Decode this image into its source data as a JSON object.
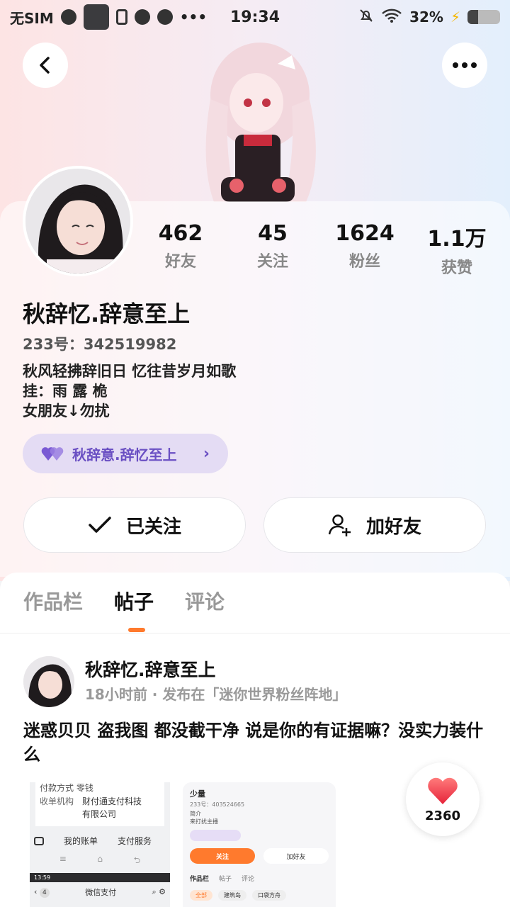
{
  "status_bar": {
    "carrier": "无SIM",
    "time": "19:34",
    "battery": "32%",
    "battery_level": 0.32
  },
  "header": {
    "back_icon": "chevron-left-icon",
    "more_icon": "more-horizontal-icon"
  },
  "profile": {
    "nickname": "秋辞忆.辞意至上",
    "uid": "233号：342519982",
    "bio_lines": [
      "秋风轻拂辞旧日 忆往昔岁月如歌",
      "挂：雨 露 桅",
      "女朋友↓勿扰"
    ],
    "tag_label": "秋辞意.辞忆至上",
    "stats": [
      {
        "num": "462",
        "label": "好友"
      },
      {
        "num": "45",
        "label": "关注"
      },
      {
        "num": "1624",
        "label": "粉丝"
      },
      {
        "num": "1.1万",
        "label": "获赞"
      }
    ]
  },
  "actions": {
    "follow_label": "已关注",
    "add_friend_label": "加好友"
  },
  "tabs": [
    "作品栏",
    "帖子",
    "评论"
  ],
  "active_tab": 1,
  "post": {
    "author": "秋辞忆.辞意至上",
    "meta": "18小时前 · 发布在「迷你世界粉丝阵地」",
    "text": "迷惑贝贝 盗我图 都没截干净 说是你的有证据嘛？没实力装什么",
    "likes": "2360",
    "thumb1": {
      "line1": "付款方式   零钱",
      "line2": "收单机构",
      "line3": "财付通支付科技",
      "line4": "有限公司",
      "bill": "我的账单",
      "service": "支付服务",
      "bar_time": "13:59",
      "back_count": "4",
      "wechat": "微信支付"
    },
    "thumb2": {
      "name": "少量",
      "id": "233号：403524665",
      "sub1": "简介",
      "sub2": "来打扰主播",
      "follow": "关注",
      "add": "加好友",
      "tab1": "作品栏",
      "tab2": "帖子",
      "tab3": "评论",
      "chip1": "全部",
      "chip2": "建筑岛",
      "chip3": "口袋方舟"
    }
  },
  "colors": {
    "accent": "#ff7a2d",
    "tag_text": "#6a4fc3",
    "tag_bg": "#e4dcf4",
    "heart": "#f23b4a"
  }
}
